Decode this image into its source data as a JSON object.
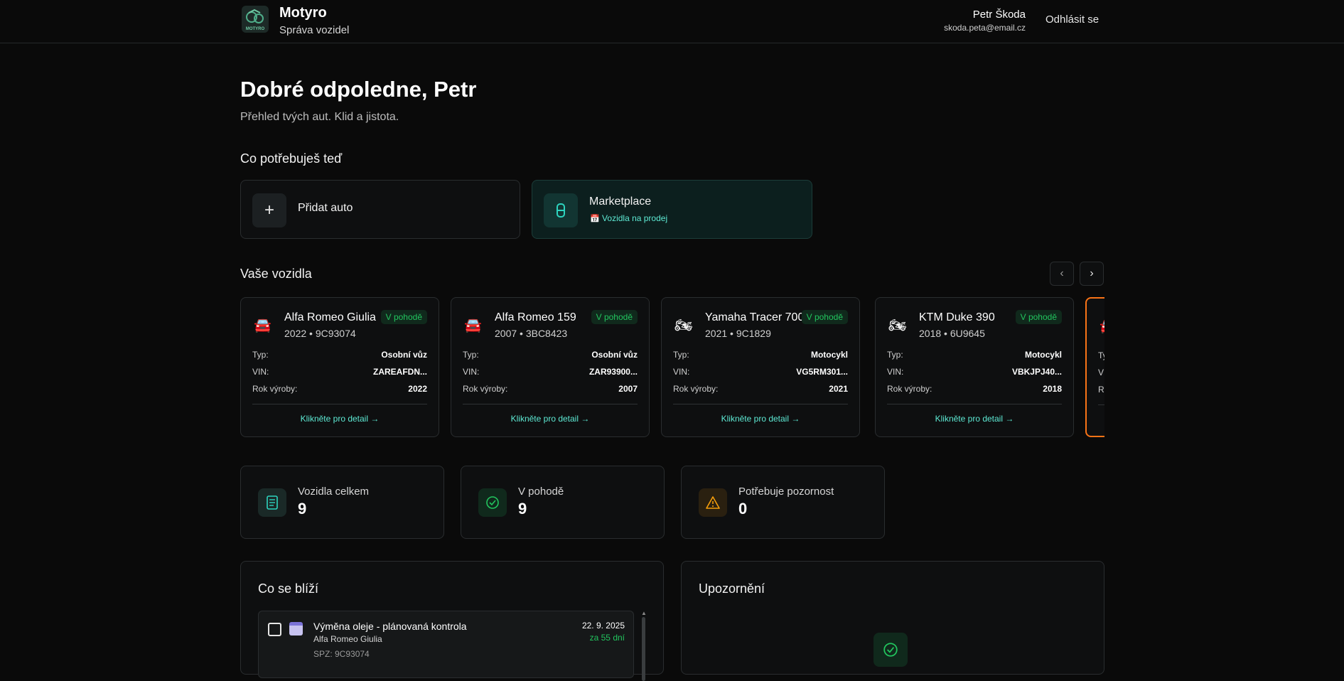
{
  "header": {
    "logo_text": "MOTYRO",
    "brand": "Motyro",
    "subtitle": "Správa vozidel",
    "user_name": "Petr Škoda",
    "user_email": "skoda.peta@email.cz",
    "logout": "Odhlásit se"
  },
  "greeting": {
    "title": "Dobré odpoledne, Petr",
    "subtitle": "Přehled tvých aut. Klid a jistota."
  },
  "actions": {
    "section_title": "Co potřebuješ teď",
    "add_car": "Přidat auto",
    "add_icon": "+",
    "marketplace": "Marketplace",
    "marketplace_sub": "Vozidla na prodej"
  },
  "vehicles": {
    "section_title": "Vaše vozidla",
    "prev_icon": "‹",
    "next_icon": "›",
    "labels": {
      "type": "Typ:",
      "vin": "VIN:",
      "year": "Rok výroby:",
      "detail": "Klikněte pro detail →"
    },
    "items": [
      {
        "name": "Alfa Romeo Giulia",
        "meta": "2022 • 9C93074",
        "badge": "V pohodě",
        "type": "Osobní vůz",
        "vin": "ZAREAFDN...",
        "year": "2022",
        "icon": "🚘"
      },
      {
        "name": "Alfa Romeo 159",
        "meta": "2007 • 3BC8423",
        "badge": "V pohodě",
        "type": "Osobní vůz",
        "vin": "ZAR93900...",
        "year": "2007",
        "icon": "🚘"
      },
      {
        "name": "Yamaha Tracer 700",
        "meta": "2021 • 9C1829",
        "badge": "V pohodě",
        "type": "Motocykl",
        "vin": "VG5RM301...",
        "year": "2021",
        "icon": "🏍"
      },
      {
        "name": "KTM Duke 390",
        "meta": "2018 • 6U9645",
        "badge": "V pohodě",
        "type": "Motocykl",
        "vin": "VBKJPJ40...",
        "year": "2018",
        "icon": "🏍"
      },
      {
        "name": "",
        "meta": "",
        "badge": "",
        "type": "",
        "vin": "",
        "year": "",
        "icon": "🚘"
      }
    ]
  },
  "stats": [
    {
      "label": "Vozidla celkem",
      "value": "9",
      "icon": "document-icon",
      "color": "#2dd4bf"
    },
    {
      "label": "V pohodě",
      "value": "9",
      "icon": "check-circle-icon",
      "color": "#22c55e"
    },
    {
      "label": "Potřebuje pozornost",
      "value": "0",
      "icon": "warning-icon",
      "color": "#f59e0b"
    }
  ],
  "upcoming": {
    "title": "Co se blíží",
    "event": {
      "title": "Výměna oleje - plánovaná kontrola",
      "car": "Alfa Romeo Giulia",
      "spz": "SPZ: 9C93074",
      "date": "22. 9. 2025",
      "in_days": "za 55 dní"
    }
  },
  "alerts": {
    "title": "Upozornění"
  },
  "colors": {
    "background": "#0a0a0a",
    "accent": "#2dd4bf",
    "ok": "#22c55e",
    "warning": "#f59e0b",
    "highlight": "#f97316"
  }
}
